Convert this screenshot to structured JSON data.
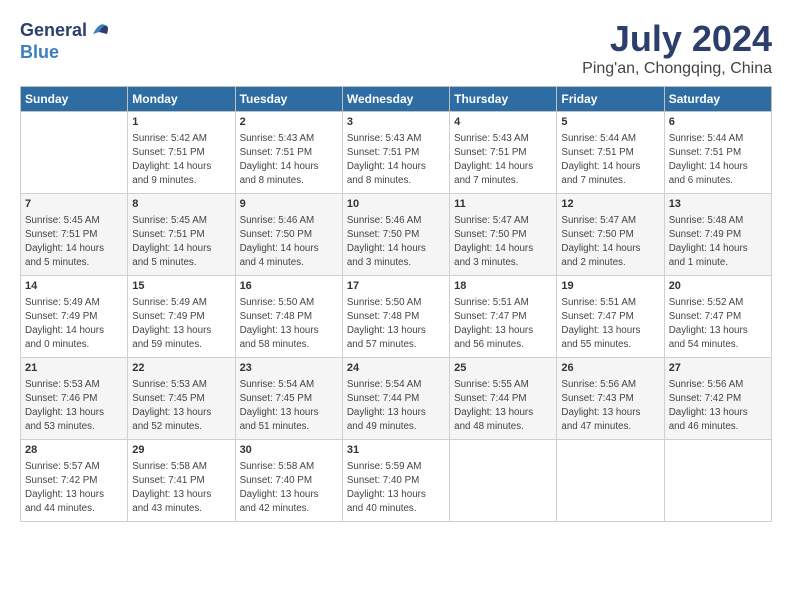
{
  "header": {
    "logo": {
      "general": "General",
      "blue": "Blue"
    },
    "title": "July 2024",
    "subtitle": "Ping'an, Chongqing, China"
  },
  "days_of_week": [
    "Sunday",
    "Monday",
    "Tuesday",
    "Wednesday",
    "Thursday",
    "Friday",
    "Saturday"
  ],
  "weeks": [
    [
      {
        "day": null,
        "content": ""
      },
      {
        "day": "1",
        "content": "Sunrise: 5:42 AM\nSunset: 7:51 PM\nDaylight: 14 hours\nand 9 minutes."
      },
      {
        "day": "2",
        "content": "Sunrise: 5:43 AM\nSunset: 7:51 PM\nDaylight: 14 hours\nand 8 minutes."
      },
      {
        "day": "3",
        "content": "Sunrise: 5:43 AM\nSunset: 7:51 PM\nDaylight: 14 hours\nand 8 minutes."
      },
      {
        "day": "4",
        "content": "Sunrise: 5:43 AM\nSunset: 7:51 PM\nDaylight: 14 hours\nand 7 minutes."
      },
      {
        "day": "5",
        "content": "Sunrise: 5:44 AM\nSunset: 7:51 PM\nDaylight: 14 hours\nand 7 minutes."
      },
      {
        "day": "6",
        "content": "Sunrise: 5:44 AM\nSunset: 7:51 PM\nDaylight: 14 hours\nand 6 minutes."
      }
    ],
    [
      {
        "day": "7",
        "content": "Sunrise: 5:45 AM\nSunset: 7:51 PM\nDaylight: 14 hours\nand 5 minutes."
      },
      {
        "day": "8",
        "content": "Sunrise: 5:45 AM\nSunset: 7:51 PM\nDaylight: 14 hours\nand 5 minutes."
      },
      {
        "day": "9",
        "content": "Sunrise: 5:46 AM\nSunset: 7:50 PM\nDaylight: 14 hours\nand 4 minutes."
      },
      {
        "day": "10",
        "content": "Sunrise: 5:46 AM\nSunset: 7:50 PM\nDaylight: 14 hours\nand 3 minutes."
      },
      {
        "day": "11",
        "content": "Sunrise: 5:47 AM\nSunset: 7:50 PM\nDaylight: 14 hours\nand 3 minutes."
      },
      {
        "day": "12",
        "content": "Sunrise: 5:47 AM\nSunset: 7:50 PM\nDaylight: 14 hours\nand 2 minutes."
      },
      {
        "day": "13",
        "content": "Sunrise: 5:48 AM\nSunset: 7:49 PM\nDaylight: 14 hours\nand 1 minute."
      }
    ],
    [
      {
        "day": "14",
        "content": "Sunrise: 5:49 AM\nSunset: 7:49 PM\nDaylight: 14 hours\nand 0 minutes."
      },
      {
        "day": "15",
        "content": "Sunrise: 5:49 AM\nSunset: 7:49 PM\nDaylight: 13 hours\nand 59 minutes."
      },
      {
        "day": "16",
        "content": "Sunrise: 5:50 AM\nSunset: 7:48 PM\nDaylight: 13 hours\nand 58 minutes."
      },
      {
        "day": "17",
        "content": "Sunrise: 5:50 AM\nSunset: 7:48 PM\nDaylight: 13 hours\nand 57 minutes."
      },
      {
        "day": "18",
        "content": "Sunrise: 5:51 AM\nSunset: 7:47 PM\nDaylight: 13 hours\nand 56 minutes."
      },
      {
        "day": "19",
        "content": "Sunrise: 5:51 AM\nSunset: 7:47 PM\nDaylight: 13 hours\nand 55 minutes."
      },
      {
        "day": "20",
        "content": "Sunrise: 5:52 AM\nSunset: 7:47 PM\nDaylight: 13 hours\nand 54 minutes."
      }
    ],
    [
      {
        "day": "21",
        "content": "Sunrise: 5:53 AM\nSunset: 7:46 PM\nDaylight: 13 hours\nand 53 minutes."
      },
      {
        "day": "22",
        "content": "Sunrise: 5:53 AM\nSunset: 7:45 PM\nDaylight: 13 hours\nand 52 minutes."
      },
      {
        "day": "23",
        "content": "Sunrise: 5:54 AM\nSunset: 7:45 PM\nDaylight: 13 hours\nand 51 minutes."
      },
      {
        "day": "24",
        "content": "Sunrise: 5:54 AM\nSunset: 7:44 PM\nDaylight: 13 hours\nand 49 minutes."
      },
      {
        "day": "25",
        "content": "Sunrise: 5:55 AM\nSunset: 7:44 PM\nDaylight: 13 hours\nand 48 minutes."
      },
      {
        "day": "26",
        "content": "Sunrise: 5:56 AM\nSunset: 7:43 PM\nDaylight: 13 hours\nand 47 minutes."
      },
      {
        "day": "27",
        "content": "Sunrise: 5:56 AM\nSunset: 7:42 PM\nDaylight: 13 hours\nand 46 minutes."
      }
    ],
    [
      {
        "day": "28",
        "content": "Sunrise: 5:57 AM\nSunset: 7:42 PM\nDaylight: 13 hours\nand 44 minutes."
      },
      {
        "day": "29",
        "content": "Sunrise: 5:58 AM\nSunset: 7:41 PM\nDaylight: 13 hours\nand 43 minutes."
      },
      {
        "day": "30",
        "content": "Sunrise: 5:58 AM\nSunset: 7:40 PM\nDaylight: 13 hours\nand 42 minutes."
      },
      {
        "day": "31",
        "content": "Sunrise: 5:59 AM\nSunset: 7:40 PM\nDaylight: 13 hours\nand 40 minutes."
      },
      {
        "day": null,
        "content": ""
      },
      {
        "day": null,
        "content": ""
      },
      {
        "day": null,
        "content": ""
      }
    ]
  ]
}
